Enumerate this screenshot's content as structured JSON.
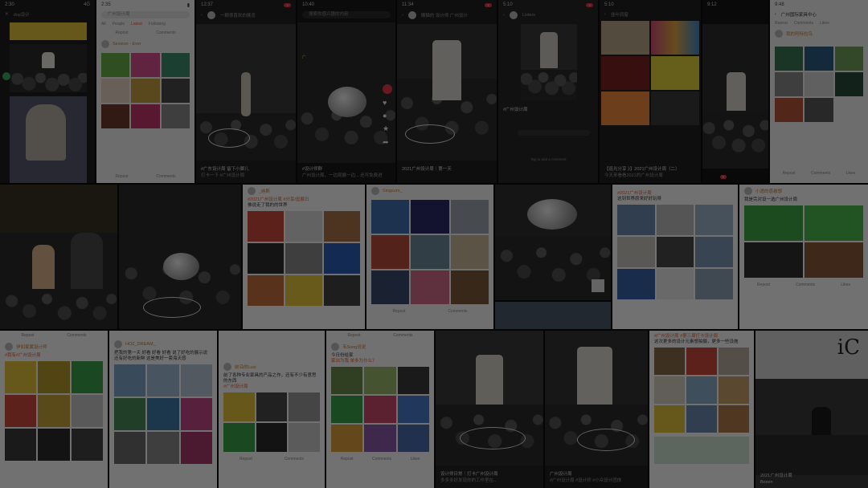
{
  "tiles": {
    "t1": {
      "time": "2:30",
      "app": "dop设计",
      "status_right": "4G"
    },
    "t2": {
      "time": "2:35",
      "search": "广州设计周",
      "tabs": [
        "All",
        "People",
        "Latest",
        "Following",
        "Topic"
      ],
      "active_tab": "Latest",
      "user": "Session - Ever",
      "foot": [
        "Repost",
        "Comments"
      ]
    },
    "t3": {
      "time": "12:37",
      "title": "一颗很喜欢的展览",
      "caption": "#广东设计周 留下小脚儿",
      "sub": "打卡一下 #广州设计周"
    },
    "t4": {
      "time": "10:40",
      "search": "搜索你感兴趣的内容",
      "caption": "#设计师群",
      "sub": "广州设计周，一边观展一边... 还可免费进"
    },
    "t5": {
      "time": "11:34",
      "title": "懒猫的 设计师 广州设计",
      "caption": "2021广州设计周｜第一天"
    },
    "t6": {
      "time": "5:10",
      "title": "Listers",
      "caption": "#广州设计周",
      "comment": "Tap to add a comment"
    },
    "t7": {
      "time": "5:10",
      "title": "韭叶同窗",
      "caption": "【逛光分享 》】2021广州设计周（二）",
      "sub": "今天来看看2021的广州设计周"
    },
    "t8": {
      "time": "9:12"
    },
    "t9": {
      "time": "9:48",
      "title": "广州国际家具中心",
      "tabs": [
        "Repost",
        "Comments",
        "Likes"
      ],
      "user": "我的阿特拉鸟",
      "foot": [
        "Repost",
        "Comments",
        "Likes"
      ]
    },
    "t10": {
      "user": "_纳斯",
      "tag": "#2021广州设计周 #分享/逛展日",
      "text": "佛说走了我的的世界"
    },
    "t11": {
      "user": "Singsum_",
      "foot": [
        "Repost",
        "Comments"
      ]
    },
    "t12": {
      "tag": "#2021广州设计周",
      "text": "这到世界原来好好玩呀"
    },
    "t13": {
      "user": "小透的感悬想",
      "text": "我是完对设一选广州设计周",
      "foot": [
        "Repost",
        "Comments",
        "Likes"
      ]
    },
    "t14": {
      "user": "伊如家属设计师",
      "tag": "#我有#广州设计周",
      "foot": [
        "Repost",
        "Comments"
      ]
    },
    "t15": {
      "user": "HOZ_DREAM_",
      "text": "把我的第一天 好看 好看 好看 说了好吃的展示说 还有好吃的新鲜 这是美好一套海天感"
    },
    "t16": {
      "user": "前沿的Lusi",
      "text": "前了各种专业家具的产品之作，还有不少有意思的东西",
      "tag": "#广州设计周",
      "foot": [
        "Repost",
        "Comments"
      ]
    },
    "t17": {
      "user": "韦Song说说",
      "text": "今日份给家",
      "tag": "家出为我 单多为什么？",
      "foot": [
        "Repost",
        "Comments",
        "Likes"
      ]
    },
    "t18": {
      "caption": "设计师日常｜打卡广州设计周",
      "sub": "多多多好发现你的工作室在..."
    },
    "t19": {
      "caption": "广州设计周",
      "sub": "#广州设计周 #设计师 #小众设计团体"
    },
    "t20": {
      "tag": "#广州设计周 #第三周打卡设计周",
      "text": "这次更多的设计元素想拍摄，更多一些设施"
    },
    "t21": {
      "caption": "2021广州设计周",
      "sub": "Bosen",
      "logo": "iC"
    }
  },
  "colors": {
    "accent": "#e85a2c",
    "badge": "#e5394c",
    "dim": "rgba(0,0,0,0.55)"
  }
}
